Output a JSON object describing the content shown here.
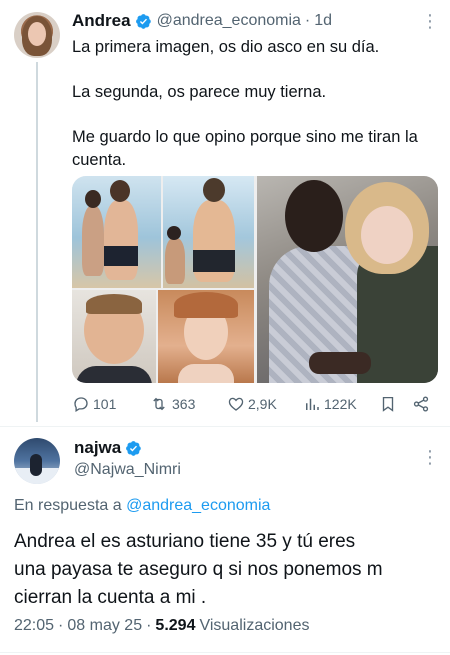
{
  "post": {
    "author_name": "Andrea",
    "author_handle": "@andrea_economia",
    "separator": "·",
    "time_ago": "1d",
    "paragraphs": [
      "La primera imagen, os dio asco en su día.",
      "La segunda, os parece muy tierna.",
      "Me guardo lo que opino porque sino me tiran la cuenta."
    ],
    "media": [
      {
        "icon": "photo-collage"
      },
      {
        "icon": "photo-couple"
      }
    ],
    "actions": {
      "reply_count": "101",
      "repost_count": "363",
      "like_count": "2,9K",
      "view_count": "122K"
    }
  },
  "reply": {
    "author_name": "najwa",
    "author_handle": "@Najwa_Nimri",
    "replying_prefix": "En respuesta a",
    "replying_handle": "@andrea_economia",
    "lines": [
      "Andrea el es asturiano tiene 35 y tú eres",
      "una payasa te aseguro q si nos ponemos m",
      "cierran la cuenta a mi ."
    ],
    "time": "22:05",
    "date": "08 may 25",
    "separator": "·",
    "views_count": "5.294",
    "views_label": "Visualizaciones"
  },
  "colors": {
    "accent": "#1d9bf0",
    "secondary_text": "#536471",
    "primary_text": "#0f1419",
    "divider": "#eff3f4"
  }
}
